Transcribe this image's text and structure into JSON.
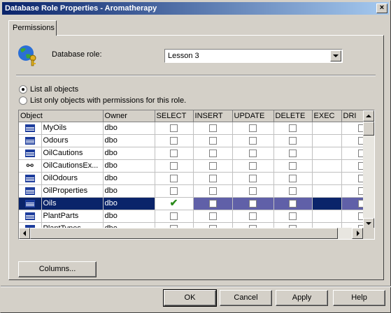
{
  "window": {
    "title": "Database Role Properties - Aromatherapy"
  },
  "tabs": [
    {
      "label": "Permissions"
    }
  ],
  "role": {
    "label": "Database role:",
    "value": "Lesson 3"
  },
  "options": {
    "list_all": "List all objects",
    "list_only": "List only objects with permissions for this role.",
    "selected": "list_all"
  },
  "grid": {
    "headers": [
      "Object",
      "Owner",
      "SELECT",
      "INSERT",
      "UPDATE",
      "DELETE",
      "EXEC",
      "DRI"
    ],
    "rows": [
      {
        "icon": "table-icon",
        "name": "MyOils",
        "owner": "dbo",
        "select": false,
        "selected": false
      },
      {
        "icon": "table-icon",
        "name": "Odours",
        "owner": "dbo",
        "select": false,
        "selected": false
      },
      {
        "icon": "table-icon",
        "name": "OilCautions",
        "owner": "dbo",
        "select": false,
        "selected": false
      },
      {
        "icon": "view-icon",
        "name": "OilCautionsEx...",
        "owner": "dbo",
        "select": false,
        "selected": false
      },
      {
        "icon": "table-icon",
        "name": "OilOdours",
        "owner": "dbo",
        "select": false,
        "selected": false
      },
      {
        "icon": "table-icon",
        "name": "OilProperties",
        "owner": "dbo",
        "select": false,
        "selected": false
      },
      {
        "icon": "table-icon",
        "name": "Oils",
        "owner": "dbo",
        "select": true,
        "selected": true
      },
      {
        "icon": "table-icon",
        "name": "PlantParts",
        "owner": "dbo",
        "select": false,
        "selected": false
      },
      {
        "icon": "table-icon",
        "name": "PlantTypes",
        "owner": "dbo",
        "select": false,
        "selected": false
      }
    ]
  },
  "buttons": {
    "columns": "Columns...",
    "ok": "OK",
    "cancel": "Cancel",
    "apply": "Apply",
    "help": "Help"
  }
}
